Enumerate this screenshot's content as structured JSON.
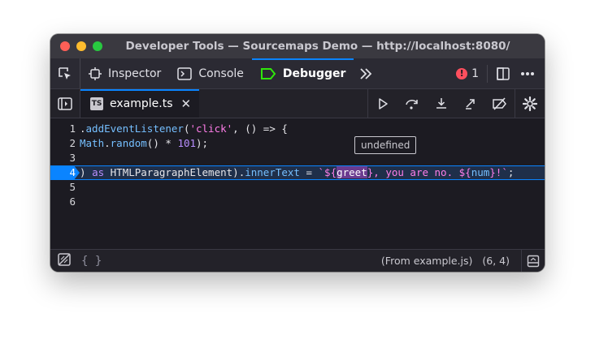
{
  "window": {
    "title": "Developer Tools — Sourcemaps Demo — http://localhost:8080/",
    "traffic_lights": [
      "#ff5f57",
      "#febc2e",
      "#28c840"
    ]
  },
  "toolbar": {
    "tabs": [
      {
        "label": "Inspector",
        "icon": "inspector-icon"
      },
      {
        "label": "Console",
        "icon": "console-icon"
      },
      {
        "label": "Debugger",
        "icon": "debugger-icon",
        "selected": true
      }
    ],
    "error_count": "1"
  },
  "source_tab": {
    "badge": "TS",
    "filename": "example.ts",
    "close": "✕"
  },
  "editor": {
    "lines": [
      {
        "number": "1",
        "segments": [
          {
            "t": ".",
            "c": ""
          },
          {
            "t": "addEventListener",
            "c": "fn"
          },
          {
            "t": "(",
            "c": ""
          },
          {
            "t": "'click'",
            "c": "str"
          },
          {
            "t": ", () => {",
            "c": ""
          }
        ]
      },
      {
        "number": "2",
        "segments": [
          {
            "t": "Math",
            "c": "fn"
          },
          {
            "t": ".",
            "c": ""
          },
          {
            "t": "random",
            "c": "fn"
          },
          {
            "t": "() * ",
            "c": ""
          },
          {
            "t": "101",
            "c": "num"
          },
          {
            "t": ");",
            "c": ""
          }
        ]
      },
      {
        "number": "3",
        "segments": []
      },
      {
        "number": "4",
        "segments": [
          {
            "t": ") ",
            "c": ""
          },
          {
            "t": "as",
            "c": "kw"
          },
          {
            "t": " HTMLParagraphElement).",
            "c": ""
          },
          {
            "t": "innerText",
            "c": "fn"
          },
          {
            "t": " = ",
            "c": ""
          },
          {
            "t": "`${",
            "c": "tplstr"
          },
          {
            "t": "greet",
            "c": "hl"
          },
          {
            "t": "}, you are no. ${",
            "c": "tplstr"
          },
          {
            "t": "num",
            "c": "fn"
          },
          {
            "t": "}!`",
            "c": "tplstr"
          },
          {
            "t": ";",
            "c": ""
          }
        ]
      },
      {
        "number": "5",
        "segments": []
      },
      {
        "number": "6",
        "segments": []
      }
    ],
    "current_line": 4,
    "tooltip": "undefined"
  },
  "footer": {
    "pretty_print": "{ }",
    "source": "(From example.js)",
    "position": "(6, 4)"
  },
  "colors": {
    "accent": "#0a84ff",
    "error": "#ff4f5e",
    "debugger_green": "#30e60b"
  }
}
